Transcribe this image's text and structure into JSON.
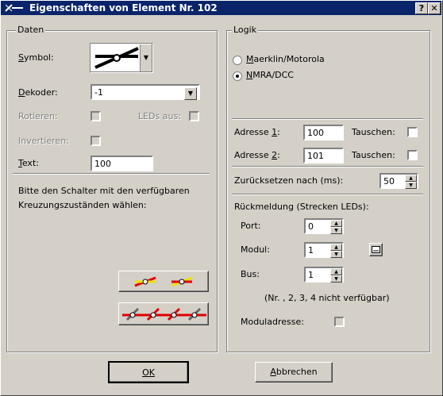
{
  "window": {
    "title": "Eigenschaften von Element Nr. 102",
    "help_button": "?",
    "close_button": "✕"
  },
  "daten": {
    "legend": "Daten",
    "symbol_label": "Symbol:",
    "dekoder_label": "Dekoder:",
    "dekoder_value": "-1",
    "rotieren_label": "Rotieren:",
    "leds_aus_label": "LEDs aus:",
    "invertieren_label": "Invertieren:",
    "text_label": "Text:",
    "text_value": "100",
    "hint": "Bitte den Schalter mit den verfügbaren Kreuzungszuständen wählen:"
  },
  "logik": {
    "legend": "Logik",
    "radio_maerklin": "Maerklin/Motorola",
    "radio_nmra": "NMRA/DCC",
    "selected_protocol": "NMRA/DCC",
    "adresse1_label": "Adresse 1:",
    "adresse1_value": "100",
    "adresse2_label": "Adresse 2:",
    "adresse2_value": "101",
    "tauschen1_label": "Tauschen:",
    "tauschen2_label": "Tauschen:",
    "reset_label": "Zurücksetzen nach (ms):",
    "reset_value": "50",
    "rueckmeldung_label": "Rückmeldung (Strecken LEDs):",
    "port_label": "Port:",
    "port_value": "0",
    "modul_label": "Modul:",
    "modul_value": "1",
    "bus_label": "Bus:",
    "bus_value": "1",
    "note": "(Nr. , 2, 3, 4 nicht verfügbar)",
    "moduladresse_label": "Moduladresse:"
  },
  "buttons": {
    "ok": "OK",
    "abbrechen": "Abbrechen"
  },
  "colors": {
    "titlebar": "#0a246a",
    "face": "#d4d0c8",
    "track_red": "#e00000",
    "track_yellow": "#f0e000"
  }
}
